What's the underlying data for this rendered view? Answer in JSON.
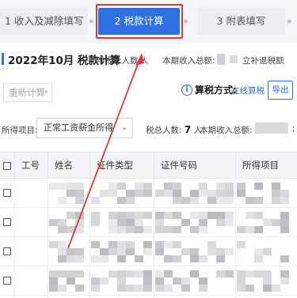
{
  "steps": [
    {
      "label": "1 收入及减除填写",
      "state": "done"
    },
    {
      "label": "2 税款计算",
      "state": "active"
    },
    {
      "label": "3 附表填写",
      "state": "todo"
    }
  ],
  "step_separator": "»",
  "header": {
    "title": "2022年10月 税款计算",
    "declare_label": "申报总人数:",
    "declare_unit": "人",
    "income_label": "本期收入总额:",
    "refund_label": "立补退税额"
  },
  "toolbar": {
    "recalc_label": "重新计算",
    "info_glyph": "i",
    "tax_mode_label": "算税方式:",
    "tax_mode_value": "在线算税",
    "export_label": "导出"
  },
  "filter": {
    "income_item_label": "所得项目:",
    "income_item_value": "正常工资薪金所得",
    "total_people_label": "税总人数:",
    "total_people_value": "7",
    "total_people_unit": "人",
    "income_total_label": "本期收入总额:",
    "trailing": ";"
  },
  "table": {
    "columns": [
      "工号",
      "姓名",
      "证件类型",
      "证件号码",
      "所得项目"
    ],
    "row_count": 4
  },
  "annotation": {
    "highlight_color": "#e23a3a",
    "arrow_color": "#e23a3a"
  },
  "colors": {
    "primary": "#2f6fe4",
    "step_bg": "#eceef2",
    "redacted": "#cfd1d6"
  },
  "icons": [
    "info-icon",
    "chevron-down-icon",
    "checkbox-icon",
    "annotation-arrow-icon"
  ]
}
